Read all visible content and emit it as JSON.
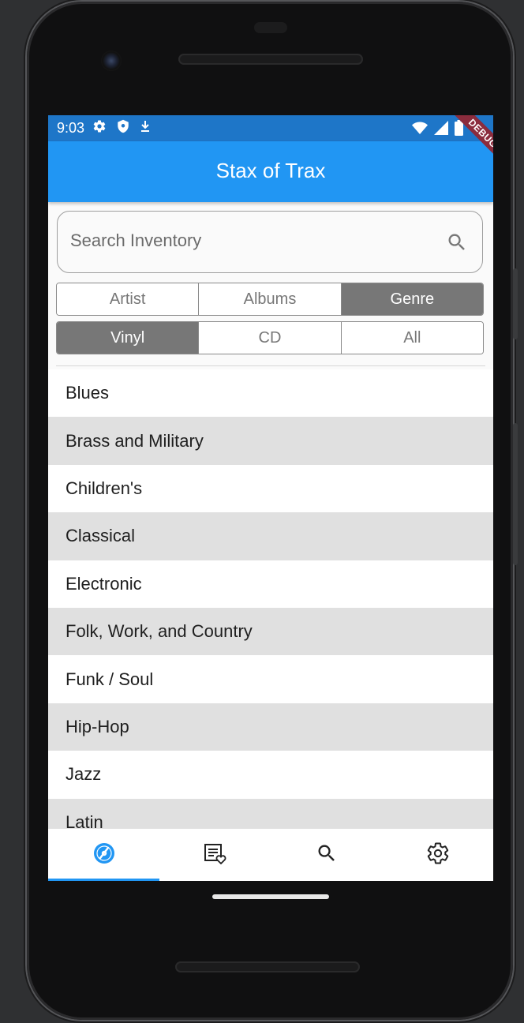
{
  "status_bar": {
    "time": "9:03",
    "icons_left": [
      "gear-icon",
      "shield-icon",
      "download-icon"
    ],
    "icons_right": [
      "wifi-icon",
      "signal-icon",
      "battery-icon"
    ]
  },
  "app_bar": {
    "title": "Stax of Trax",
    "debug_banner": "DEBUG"
  },
  "search": {
    "placeholder": "Search Inventory"
  },
  "filter_by": {
    "options": [
      "Artist",
      "Albums",
      "Genre"
    ],
    "selected": "Genre"
  },
  "format": {
    "options": [
      "Vinyl",
      "CD",
      "All"
    ],
    "selected": "Vinyl"
  },
  "genres": [
    "Blues",
    "Brass and Military",
    "Children's",
    "Classical",
    "Electronic",
    "Folk, Work, and Country",
    "Funk / Soul",
    "Hip-Hop",
    "Jazz",
    "Latin"
  ],
  "bottom_nav": {
    "tabs": [
      "record-icon",
      "wishlist-icon",
      "search-icon",
      "settings-icon"
    ],
    "active_index": 0,
    "colors": {
      "active": "#2196f3",
      "inactive": "#222222"
    }
  },
  "colors": {
    "app_bar": "#2196f3",
    "status_bar": "#1e76c8",
    "segment_selected": "#777777",
    "row_alt": "#e0e0e0"
  }
}
